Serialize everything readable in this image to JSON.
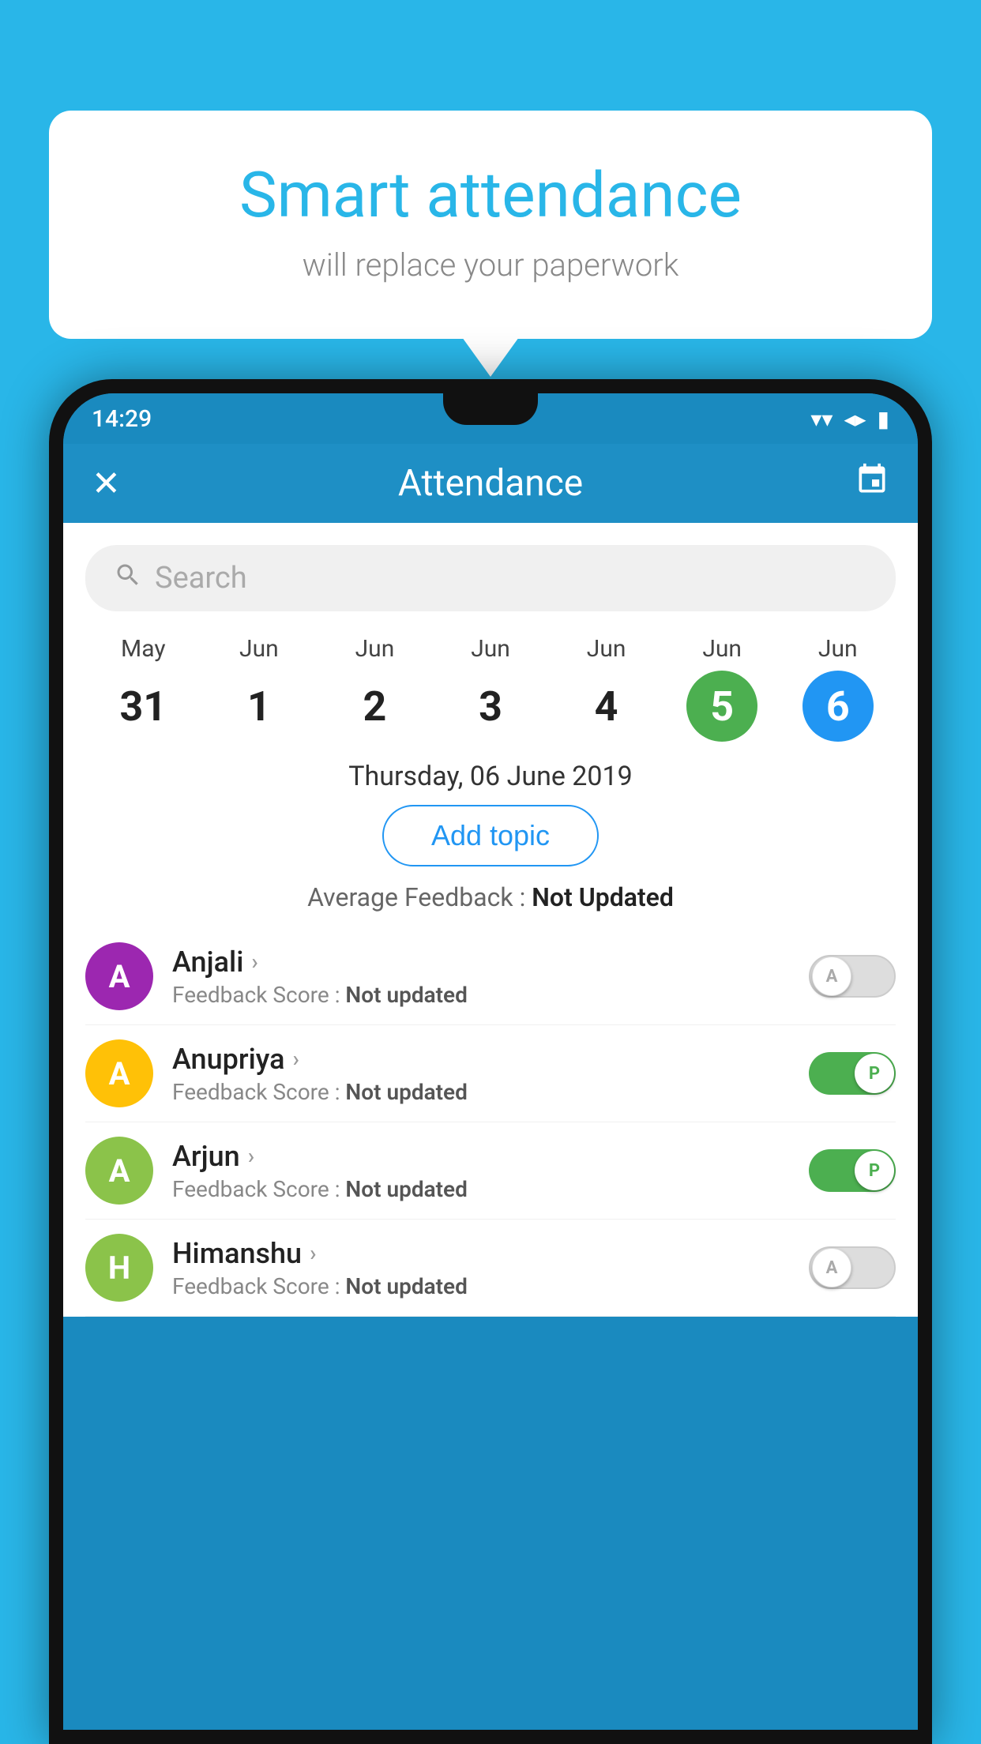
{
  "background_color": "#29b6e8",
  "bubble": {
    "title": "Smart attendance",
    "subtitle": "will replace your paperwork"
  },
  "status_bar": {
    "time": "14:29",
    "wifi": "▼",
    "signal": "▲",
    "battery": "▮"
  },
  "app_bar": {
    "close_icon": "✕",
    "title": "Attendance",
    "calendar_icon": "📅"
  },
  "search": {
    "placeholder": "Search"
  },
  "calendar": {
    "days": [
      {
        "month": "May",
        "date": "31",
        "style": "normal"
      },
      {
        "month": "Jun",
        "date": "1",
        "style": "normal"
      },
      {
        "month": "Jun",
        "date": "2",
        "style": "normal"
      },
      {
        "month": "Jun",
        "date": "3",
        "style": "normal"
      },
      {
        "month": "Jun",
        "date": "4",
        "style": "normal"
      },
      {
        "month": "Jun",
        "date": "5",
        "style": "green"
      },
      {
        "month": "Jun",
        "date": "6",
        "style": "blue"
      }
    ]
  },
  "selected_date": "Thursday, 06 June 2019",
  "add_topic_label": "Add topic",
  "avg_feedback_label": "Average Feedback : ",
  "avg_feedback_value": "Not Updated",
  "students": [
    {
      "name": "Anjali",
      "avatar_letter": "A",
      "avatar_color": "#9c27b0",
      "score_label": "Feedback Score : ",
      "score_value": "Not updated",
      "toggle": "off",
      "toggle_letter": "A"
    },
    {
      "name": "Anupriya",
      "avatar_letter": "A",
      "avatar_color": "#ffc107",
      "score_label": "Feedback Score : ",
      "score_value": "Not updated",
      "toggle": "on",
      "toggle_letter": "P"
    },
    {
      "name": "Arjun",
      "avatar_letter": "A",
      "avatar_color": "#8bc34a",
      "score_label": "Feedback Score : ",
      "score_value": "Not updated",
      "toggle": "on",
      "toggle_letter": "P"
    },
    {
      "name": "Himanshu",
      "avatar_letter": "H",
      "avatar_color": "#8bc34a",
      "score_label": "Feedback Score : ",
      "score_value": "Not updated",
      "toggle": "off",
      "toggle_letter": "A"
    }
  ]
}
